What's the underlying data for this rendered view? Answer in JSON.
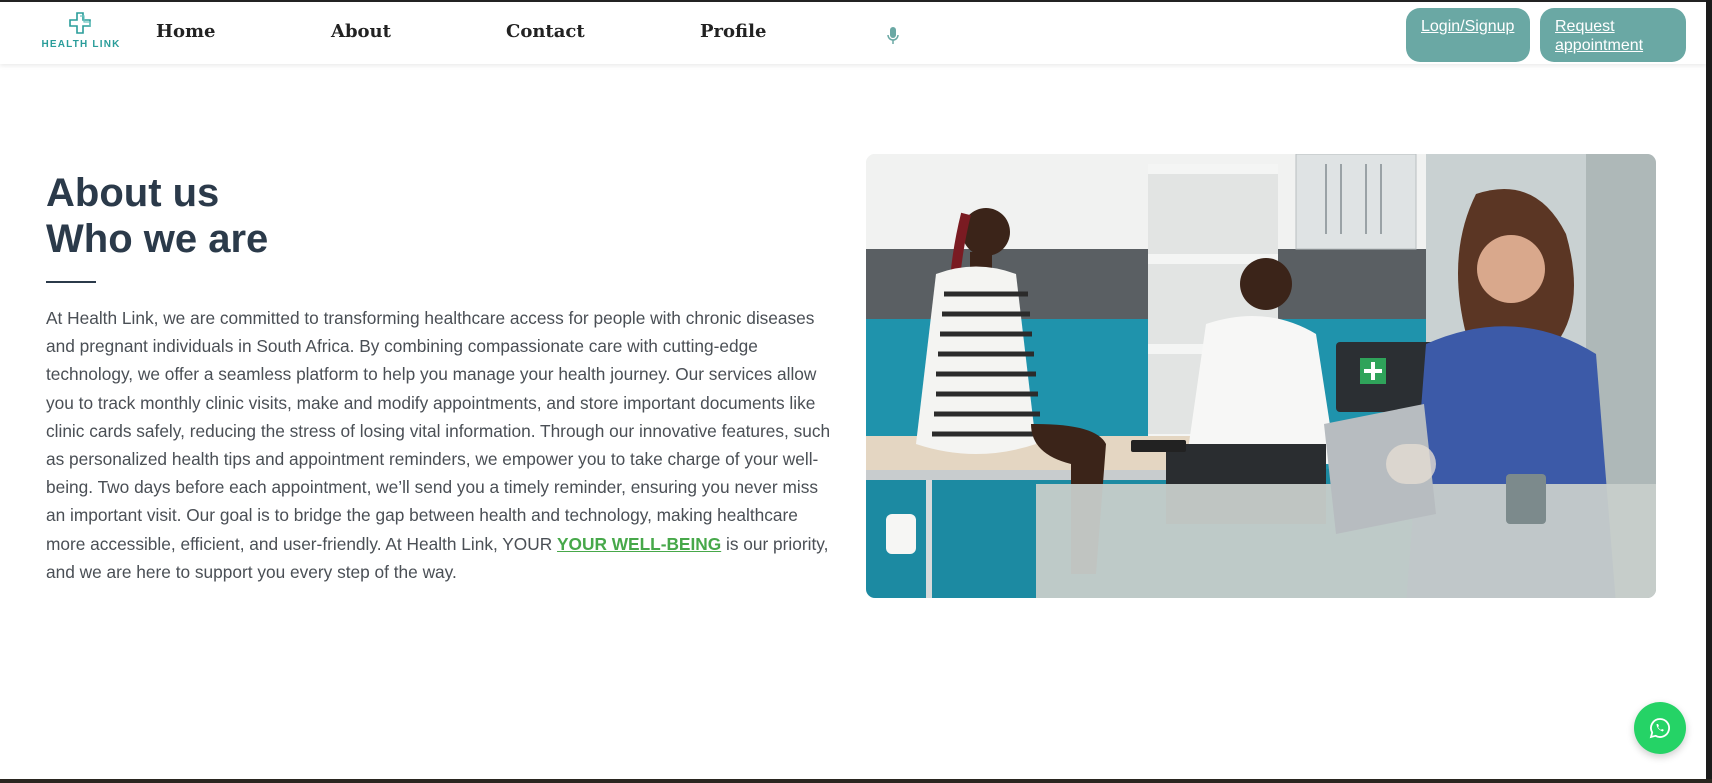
{
  "brand": {
    "name": "HEALTH LINK",
    "color": "#2a9d9a"
  },
  "nav": {
    "home": "Home",
    "about": "About",
    "contact": "Contact",
    "profile": "Profile",
    "mic_icon": "microphone-icon"
  },
  "header_buttons": {
    "login": "Login/Signup",
    "request": "Request appointment",
    "color": "#6aa8a4"
  },
  "about": {
    "title_line1": "About us",
    "title_line2": "Who we are",
    "paragraph": "At Health Link, we are committed to transforming healthcare access for people with chronic diseases and pregnant individuals in South Africa. By combining compassionate care with cutting-edge technology, we offer a seamless platform to help you manage your health journey. Our services allow you to track monthly clinic visits, make and modify appointments, and store important documents like clinic cards safely, reducing the stress of losing vital information. Through our innovative features, such as personalized health tips and appointment reminders, we empower you to take charge of your well-being. Two days before each appointment, we’ll send you a timely reminder, ensuring you never miss an important visit. Our goal is to bridge the gap between health and technology, making healthcare more accessible, efficient, and user-friendly. At Health Link, YOUR",
    "highlight": "YOUR WELL-BEING",
    "paragraph_end": "is our priority, and we are here to support you every step of the way.",
    "highlight_color": "#47a84a"
  },
  "image": {
    "description_icon": "clinic-consultation-photo"
  },
  "floating": {
    "icon": "whatsapp-icon",
    "color": "#25d366"
  }
}
